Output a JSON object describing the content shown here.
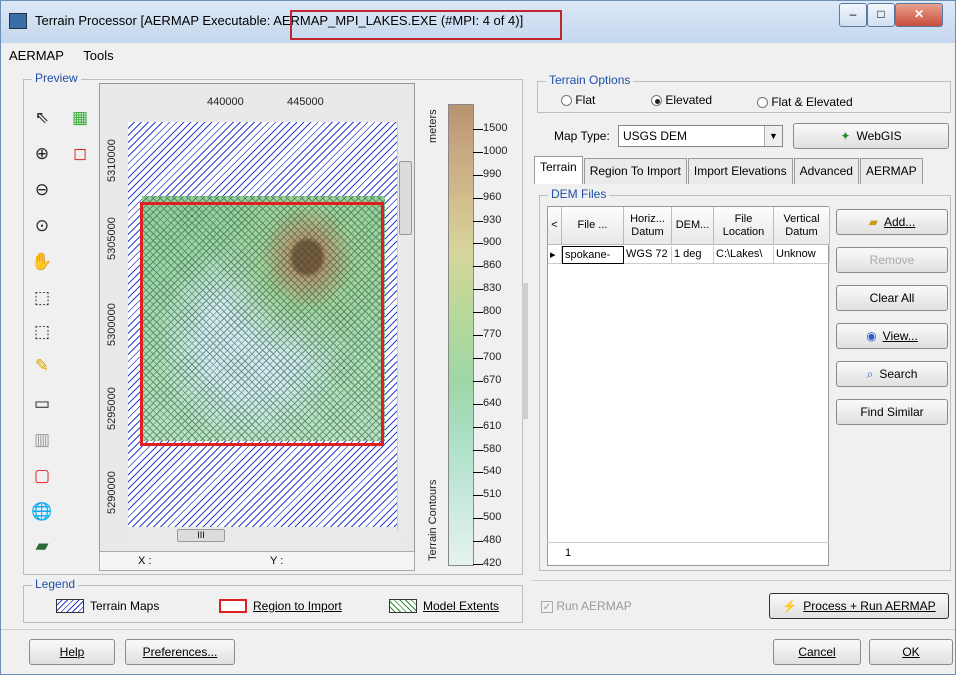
{
  "window": {
    "title_prefix": "Terrain Processor [AERMAP Executable: ",
    "title_highlight": "AERMAP_MPI_LAKES.EXE (#MPI: 4 of 4)]",
    "minimize": "–",
    "maximize": "□",
    "close": "✕"
  },
  "menu": {
    "items": [
      "AERMAP",
      "Tools"
    ]
  },
  "preview": {
    "title": "Preview",
    "x_ticks": [
      "440000",
      "445000"
    ],
    "y_ticks": [
      "5310000",
      "5305000",
      "5300000",
      "5295000",
      "5290000"
    ],
    "colorbar_unit": "meters",
    "colorbar_label": "Terrain Contours",
    "colorbar_ticks": [
      "1500",
      "1000",
      "990",
      "960",
      "930",
      "900",
      "860",
      "830",
      "800",
      "770",
      "700",
      "670",
      "640",
      "610",
      "580",
      "540",
      "510",
      "500",
      "480",
      "420"
    ],
    "coord_x": "X :",
    "coord_y": "Y :",
    "scroll_grip": "III"
  },
  "legend": {
    "title": "Legend",
    "terrain_maps": "Terrain Maps",
    "region_to_import": "Region to Import",
    "model_extents": "Model Extents"
  },
  "terrain_options": {
    "title": "Terrain Options",
    "flat": "Flat",
    "elevated": "Elevated",
    "flat_elevated": "Flat & Elevated",
    "selected": "Elevated",
    "map_type_label": "Map Type:",
    "map_type_value": "USGS DEM",
    "webgis": "WebGIS"
  },
  "tabs": [
    "Terrain",
    "Region To Import",
    "Import Elevations",
    "Advanced",
    "AERMAP"
  ],
  "dem_files": {
    "title": "DEM Files",
    "columns": [
      "",
      "File ...",
      "Horiz... Datum",
      "DEM...",
      "File Location",
      "Vertical Datum"
    ],
    "row": [
      "spokane-",
      "WGS 72",
      "1 deg",
      "C:\\Lakes\\",
      "Unknow"
    ],
    "footer_value": "1"
  },
  "side_buttons": {
    "add": "Add...",
    "remove": "Remove",
    "clear_all": "Clear All",
    "view": "View...",
    "search": "Search",
    "find_similar": "Find Similar"
  },
  "run_aermap": "Run AERMAP",
  "process_run": "Process + Run AERMAP",
  "bottom": {
    "help": "Help",
    "preferences": "Preferences...",
    "cancel": "Cancel",
    "ok": "OK"
  }
}
